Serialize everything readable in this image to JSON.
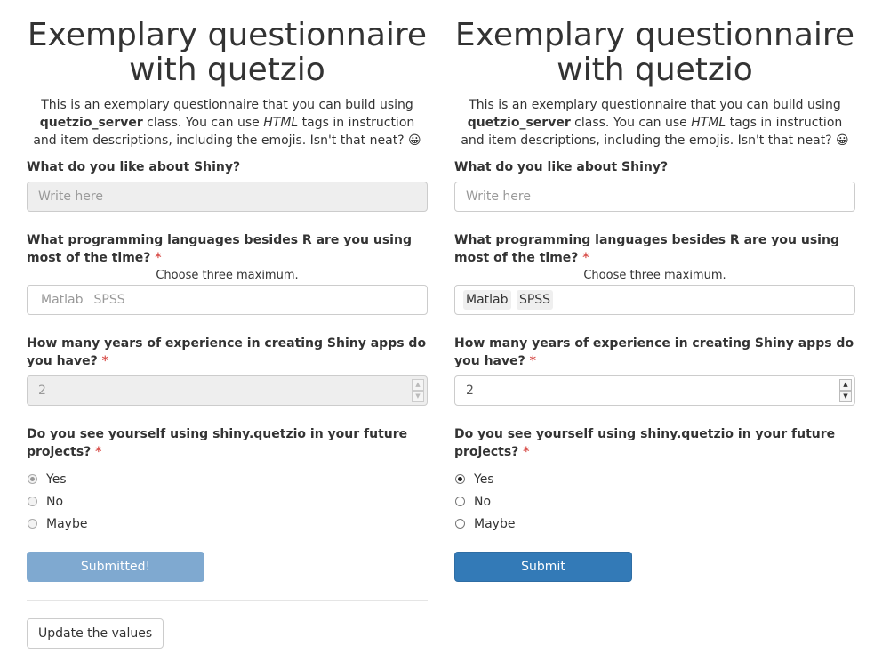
{
  "title": "Exemplary questionnaire with quetzio",
  "description": {
    "p1": "This is an exemplary questionnaire that you can build using ",
    "bold": "quetzio_server",
    "p2": " class. You can use ",
    "italic": "HTML",
    "p3": " tags in instruction and item descriptions, including the emojis. Isn't that neat? 😀"
  },
  "q1": {
    "label": "What do you like about Shiny?",
    "placeholder": "Write here"
  },
  "q2": {
    "label": "What programming languages besides R are you using most of the time?",
    "required": "*",
    "hint": "Choose three maximum.",
    "tags": [
      "Matlab",
      "SPSS"
    ]
  },
  "q3": {
    "label": "How many years of experience in creating Shiny apps do you have?",
    "required": "*",
    "value": "2",
    "spin_up": "▲",
    "spin_down": "▼"
  },
  "q4": {
    "label": "Do you see yourself using shiny.quetzio in your future projects?",
    "required": "*",
    "options": [
      "Yes",
      "No",
      "Maybe"
    ],
    "selected": "Yes"
  },
  "left": {
    "submit_label": "Submitted!"
  },
  "right": {
    "submit_label": "Submit"
  },
  "update_button": "Update the values",
  "colors": {
    "primary": "#337ab7",
    "primary_disabled": "#7fa9d0",
    "required": "#d9534f"
  }
}
